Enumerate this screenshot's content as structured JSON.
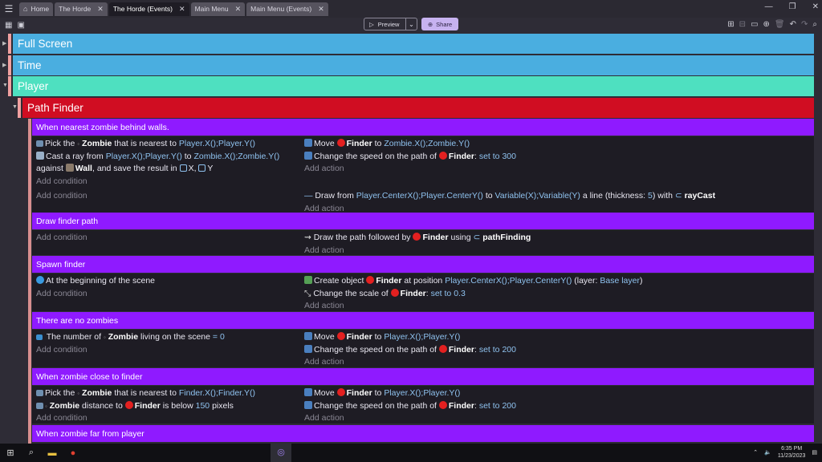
{
  "tabs": [
    {
      "label": "Home",
      "active": false
    },
    {
      "label": "The Horde",
      "active": false
    },
    {
      "label": "The Horde (Events)",
      "active": true
    },
    {
      "label": "Main Menu",
      "active": false
    },
    {
      "label": "Main Menu (Events)",
      "active": false
    }
  ],
  "toolbar": {
    "preview_label": "Preview",
    "share_label": "Share"
  },
  "groups": {
    "full_screen": "Full Screen",
    "time": "Time",
    "player": "Player",
    "path_finder": "Path Finder"
  },
  "events": {
    "e1": {
      "title": "When nearest zombie behind walls.",
      "c1": {
        "a": "Pick the",
        "obj": "Zombie",
        "b": "that is nearest to",
        "expr": "Player.X();Player.Y()"
      },
      "c2": {
        "a": "Cast a ray from",
        "expr1": "Player.X();Player.Y()",
        "b": "to",
        "expr2": "Zombie.X();Zombie.Y()"
      },
      "c3": {
        "a": "against",
        "obj": "Wall",
        "b": ", and save the result in",
        "v1": "X",
        "v2": "Y"
      },
      "a1": {
        "a": "Move",
        "obj": "Finder",
        "b": "to",
        "expr": "Zombie.X();Zombie.Y()"
      },
      "a2": {
        "a": "Change the speed on the path of",
        "obj": "Finder",
        "b": ":",
        "c": "set to",
        "val": "300"
      },
      "a3": {
        "a": "Draw from",
        "expr1": "Player.CenterX();Player.CenterY()",
        "b": "to",
        "expr2": "Variable(X);Variable(Y)",
        "c": "a line (thickness:",
        "val": "5",
        "d": ") with",
        "obj": "rayCast"
      }
    },
    "e2": {
      "title": "Draw finder path",
      "a1": {
        "a": "Draw the path followed by",
        "obj": "Finder",
        "b": "using",
        "obj2": "pathFinding"
      }
    },
    "e3": {
      "title": "Spawn finder",
      "c1": {
        "a": "At the beginning of the scene"
      },
      "a1": {
        "a": "Create object",
        "obj": "Finder",
        "b": "at position",
        "expr": "Player.CenterX();Player.CenterY()",
        "c": "(layer:",
        "layer": "Base layer",
        "d": ")"
      },
      "a2": {
        "a": "Change the scale of",
        "obj": "Finder",
        "b": ":",
        "c": "set to",
        "val": "0.3"
      }
    },
    "e4": {
      "title": "There are no zombies",
      "c1": {
        "a": "The number of",
        "obj": "Zombie",
        "b": "living on the scene",
        "c": "=",
        "val": "0"
      },
      "a1": {
        "a": "Move",
        "obj": "Finder",
        "b": "to",
        "expr": "Player.X();Player.Y()"
      },
      "a2": {
        "a": "Change the speed on the path of",
        "obj": "Finder",
        "b": ":",
        "c": "set to",
        "val": "200"
      }
    },
    "e5": {
      "title": "When zombie close to finder",
      "c1": {
        "a": "Pick the",
        "obj": "Zombie",
        "b": "that is nearest to",
        "expr": "Finder.X();Finder.Y()"
      },
      "c2": {
        "obj": "Zombie",
        "a": "distance to",
        "obj2": "Finder",
        "b": "is below",
        "val": "150",
        "c": "pixels"
      },
      "a1": {
        "a": "Move",
        "obj": "Finder",
        "b": "to",
        "expr": "Player.X();Player.Y()"
      },
      "a2": {
        "a": "Change the speed on the path of",
        "obj": "Finder",
        "b": ":",
        "c": "set to",
        "val": "200"
      }
    },
    "e6": {
      "title": "When zombie far from player"
    }
  },
  "add_condition": "Add condition",
  "add_action": "Add action",
  "taskbar": {
    "time": "6:35 PM",
    "date": "11/23/2023"
  },
  "colors": {
    "full_screen": "#4aaee0",
    "time": "#4aaee0",
    "player": "#4ee0c0",
    "path_finder": "#d00d22",
    "event_header": "#8f1aff"
  }
}
